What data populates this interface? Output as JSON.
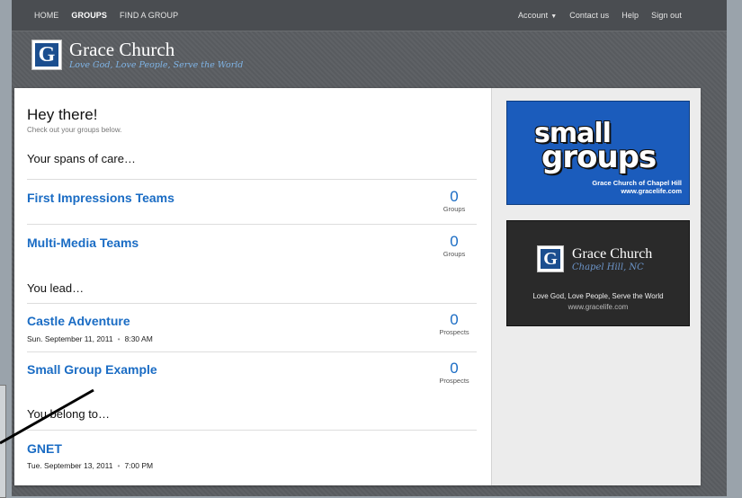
{
  "nav": {
    "left": [
      "HOME",
      "GROUPS",
      "FIND A GROUP"
    ],
    "active": "GROUPS",
    "right": {
      "account": "Account",
      "contact": "Contact us",
      "help": "Help",
      "signout": "Sign out"
    }
  },
  "brand": {
    "title": "Grace Church",
    "tagline": "Love God, Love People, Serve the World",
    "logo_letter": "G"
  },
  "main": {
    "greeting": "Hey there!",
    "subtitle": "Check out your groups below.",
    "sections": {
      "spans": "Your spans of care…",
      "lead": "You lead…",
      "belong": "You belong to…"
    },
    "spans": [
      {
        "title": "First Impressions Teams",
        "count": "0",
        "count_label": "Groups"
      },
      {
        "title": "Multi-Media Teams",
        "count": "0",
        "count_label": "Groups"
      }
    ],
    "lead": [
      {
        "title": "Castle Adventure",
        "day": "Sun. September 11, 2011",
        "time": "8:30 AM",
        "count": "0",
        "count_label": "Prospects"
      },
      {
        "title": "Small Group Example",
        "count": "0",
        "count_label": "Prospects"
      }
    ],
    "belong": [
      {
        "title": "GNET",
        "day": "Tue. September 13, 2011",
        "time": "7:00 PM"
      }
    ]
  },
  "sidebar": {
    "ad1": {
      "word1": "small",
      "word2": "groups",
      "line1": "Grace Church of Chapel Hill",
      "line2": "www.gracelife.com"
    },
    "ad2": {
      "title": "Grace Church",
      "subtitle": "Chapel Hill, NC",
      "line1": "Love God, Love People, Serve the World",
      "line2": "www.gracelife.com",
      "logo_letter": "G"
    }
  },
  "colors": {
    "link": "#1a6cc4",
    "ad_blue": "#1b5cbc",
    "frame": "#5b5e62"
  }
}
